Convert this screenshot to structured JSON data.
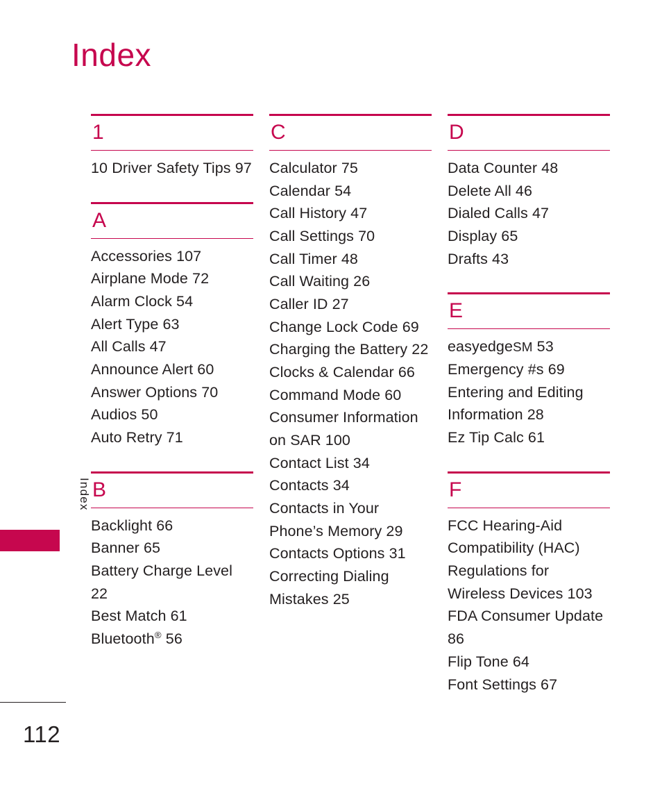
{
  "page": {
    "title": "Index",
    "side_tab_label": "Index",
    "page_number": "112",
    "accent_color": "#C6074E",
    "text_color": "#231f20",
    "background_color": "#ffffff"
  },
  "columns": [
    {
      "id": "column-1",
      "sections": [
        {
          "letter": "1",
          "entries": [
            "10 Driver Safety Tips 97"
          ]
        },
        {
          "letter": "A",
          "entries": [
            "Accessories 107",
            "Airplane Mode 72",
            "Alarm Clock 54",
            "Alert Type 63",
            "All Calls 47",
            "Announce Alert 60",
            "Answer Options 70",
            "Audios 50",
            "Auto Retry 71"
          ]
        },
        {
          "letter": "B",
          "entries": [
            "Backlight 66",
            "Banner 65",
            "Battery Charge Level 22",
            "Best Match 61",
            "Bluetooth® 56"
          ]
        }
      ]
    },
    {
      "id": "column-2",
      "sections": [
        {
          "letter": "C",
          "entries": [
            "Calculator 75",
            "Calendar 54",
            "Call History 47",
            "Call Settings 70",
            "Call Timer 48",
            "Call Waiting 26",
            "Caller ID 27",
            "Change Lock Code 69",
            "Charging the Battery 22",
            "Clocks & Calendar 66",
            "Command Mode 60",
            "Consumer Information on SAR 100",
            "Contact List 34",
            "Contacts 34",
            "Contacts in Your Phone’s Memory 29",
            "Contacts Options 31",
            "Correcting Dialing Mistakes 25"
          ]
        }
      ]
    },
    {
      "id": "column-3",
      "sections": [
        {
          "letter": "D",
          "entries": [
            "Data Counter 48",
            "Delete All 46",
            "Dialed Calls 47",
            "Display 65",
            "Drafts 43"
          ]
        },
        {
          "letter": "E",
          "entries": [
            "easyedgeSM 53",
            "Emergency #s 69",
            "Entering and Editing Information 28",
            "Ez Tip Calc 61"
          ]
        },
        {
          "letter": "F",
          "entries": [
            "FCC Hearing-Aid Compatibility (HAC) Regulations for Wireless Devices 103",
            "FDA Consumer Update 86",
            "Flip Tone 64",
            "Font Settings 67"
          ]
        }
      ]
    }
  ]
}
